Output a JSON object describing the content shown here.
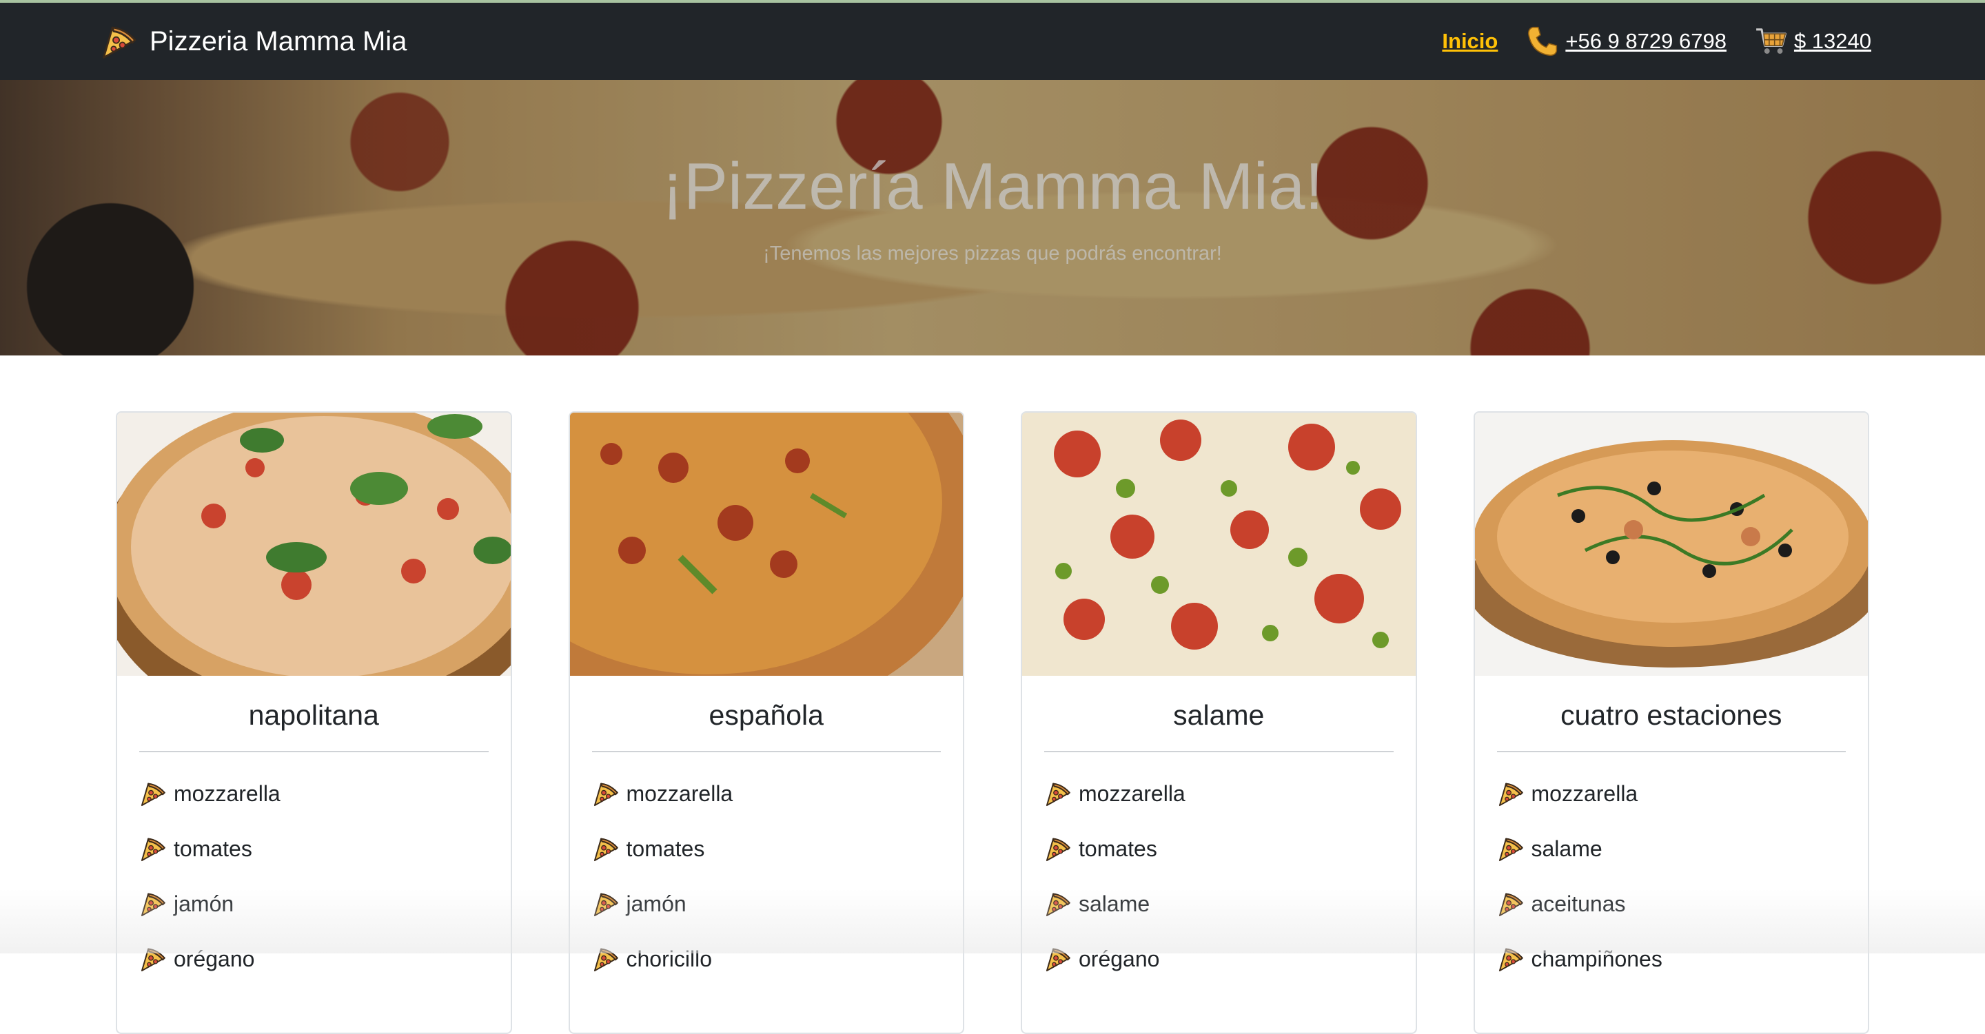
{
  "navbar": {
    "brand": "Pizzeria Mamma Mia",
    "brand_icon": "pizza-slice-icon",
    "links": [
      {
        "label": "Inicio",
        "icon": null,
        "active": true
      },
      {
        "label": "+56 9 8729 6798",
        "icon": "phone-icon",
        "active": false
      },
      {
        "label": " $ 13240",
        "icon": "cart-icon",
        "active": false
      }
    ],
    "colors": {
      "background": "#212529",
      "active": "#ffc107",
      "text": "#ffffff"
    }
  },
  "hero": {
    "title": "¡Pizzería Mamma Mia!",
    "subtitle": "¡Tenemos las mejores pizzas que podrás encontrar!"
  },
  "pizzas": [
    {
      "name": "napolitana",
      "ingredients": [
        "mozzarella",
        "tomates",
        "jamón",
        "orégano"
      ]
    },
    {
      "name": "española",
      "ingredients": [
        "mozzarella",
        "tomates",
        "jamón",
        "choricillo"
      ]
    },
    {
      "name": "salame",
      "ingredients": [
        "mozzarella",
        "tomates",
        "salame",
        "orégano"
      ]
    },
    {
      "name": "cuatro estaciones",
      "ingredients": [
        "mozzarella",
        "salame",
        "aceitunas",
        "champiñones"
      ]
    }
  ]
}
